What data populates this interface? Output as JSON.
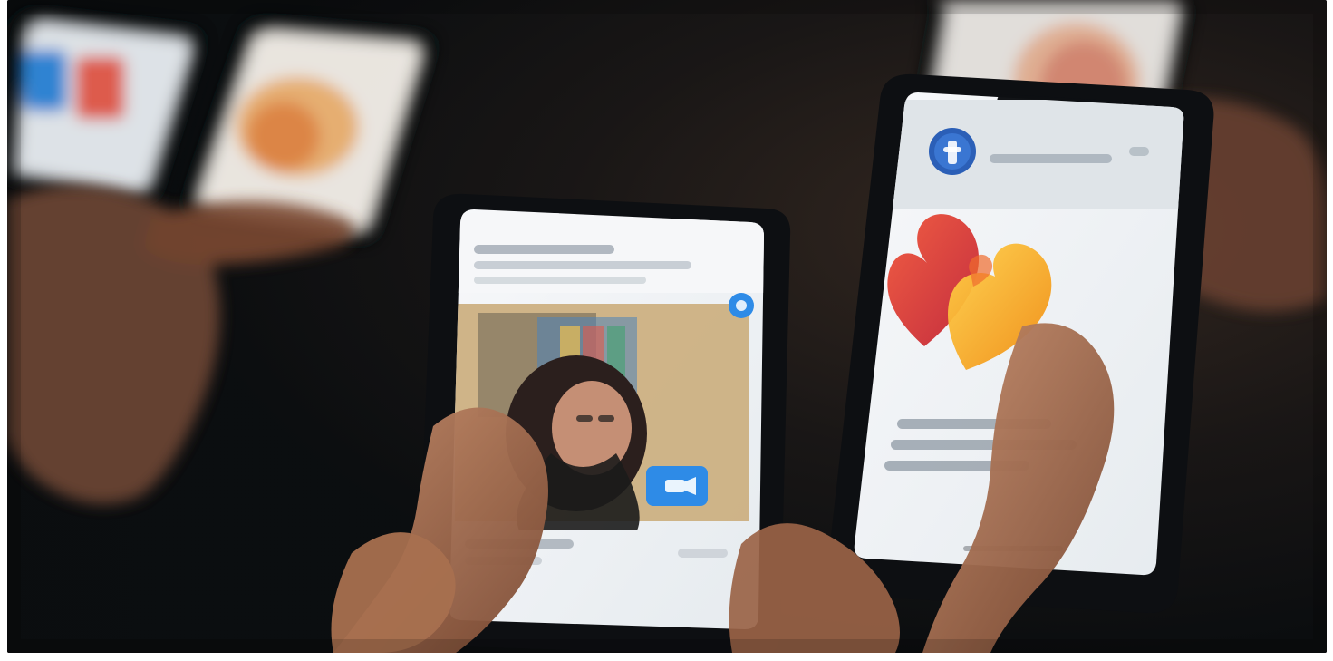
{
  "image": {
    "kind": "photo",
    "content": [
      "hands-holding-smartphones",
      "dating-app-screen",
      "video-call-screen"
    ]
  },
  "icons": {
    "brand_badge": "facebook-dating-badge",
    "hearts": "dating-hearts-icon",
    "video_button": "video-camera-icon"
  },
  "colors": {
    "background_dark": "#0f1416",
    "background_warm": "#2b1f1a",
    "phone_black": "#0d0f12",
    "screen_white": "#f2f4f6",
    "header_gray": "#dfe4e8",
    "heart_red": "#e1453f",
    "heart_orange": "#f2a51a",
    "accent_blue": "#2e8be7",
    "skin": "#b47b5b",
    "skin_shadow": "#7b4a33"
  }
}
